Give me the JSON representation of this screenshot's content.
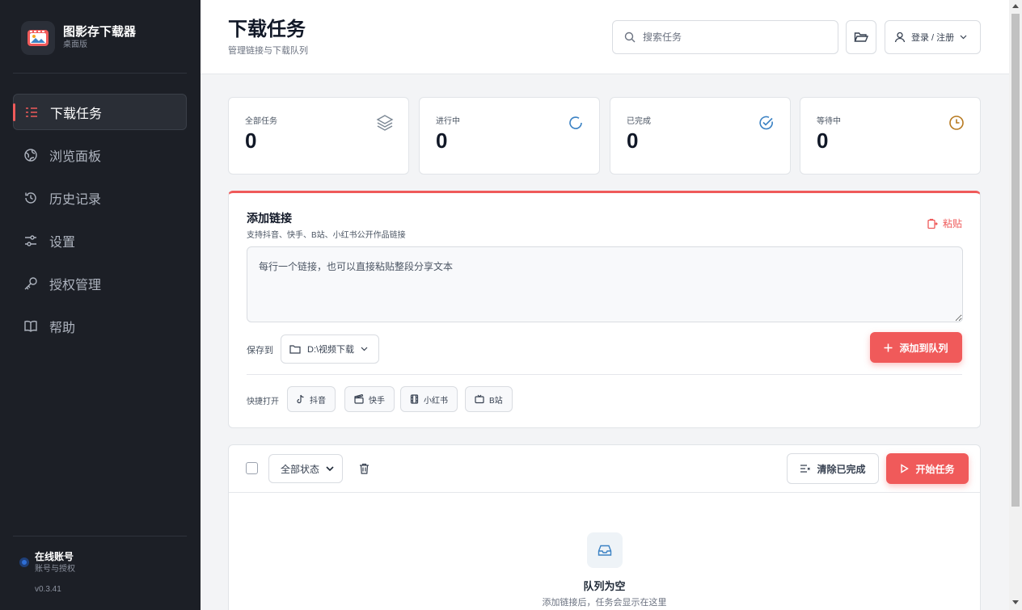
{
  "app": {
    "name": "图影存下载器",
    "edition": "桌面版"
  },
  "sidebar": {
    "items": [
      {
        "label": "下载任务",
        "icon": "list-icon",
        "active": true
      },
      {
        "label": "浏览面板",
        "icon": "globe-icon",
        "active": false
      },
      {
        "label": "历史记录",
        "icon": "history-icon",
        "active": false
      },
      {
        "label": "设置",
        "icon": "sliders-icon",
        "active": false
      },
      {
        "label": "授权管理",
        "icon": "key-icon",
        "active": false
      },
      {
        "label": "帮助",
        "icon": "book-icon",
        "active": false
      }
    ],
    "account": {
      "name": "在线账号",
      "sub": "账号与授权"
    },
    "version": "v0.3.41"
  },
  "header": {
    "title": "下载任务",
    "subtitle": "管理链接与下载队列",
    "search_placeholder": "搜索任务",
    "login_label": "登录 / 注册"
  },
  "stats": [
    {
      "label": "全部任务",
      "value": "0",
      "icon": "layers-icon",
      "color": "#7b8794"
    },
    {
      "label": "进行中",
      "value": "0",
      "icon": "spinner-icon",
      "color": "#3b82c4"
    },
    {
      "label": "已完成",
      "value": "0",
      "icon": "check-circle-icon",
      "color": "#3b82c4"
    },
    {
      "label": "等待中",
      "value": "0",
      "icon": "clock-icon",
      "color": "#b7791f"
    }
  ],
  "add_link": {
    "title": "添加链接",
    "subtitle": "支持抖音、快手、B站、小红书公开作品链接",
    "paste_label": "粘贴",
    "textarea_placeholder": "每行一个链接，也可以直接粘贴整段分享文本",
    "save_label": "保存到",
    "save_path": "D:\\视频下载",
    "add_button": "添加到队列",
    "quick_label": "快捷打开",
    "quick_links": [
      {
        "label": "抖音",
        "icon": "music-note-icon"
      },
      {
        "label": "快手",
        "icon": "clapper-icon"
      },
      {
        "label": "小红书",
        "icon": "film-icon"
      },
      {
        "label": "B站",
        "icon": "tv-icon"
      }
    ]
  },
  "queue": {
    "filter_selected": "全部状态",
    "clear_button": "清除已完成",
    "start_button": "开始任务",
    "empty_title": "队列为空",
    "empty_subtitle": "添加链接后，任务会显示在这里"
  },
  "colors": {
    "accent": "#f05a5a",
    "sidebar_bg": "#1c1f26"
  }
}
